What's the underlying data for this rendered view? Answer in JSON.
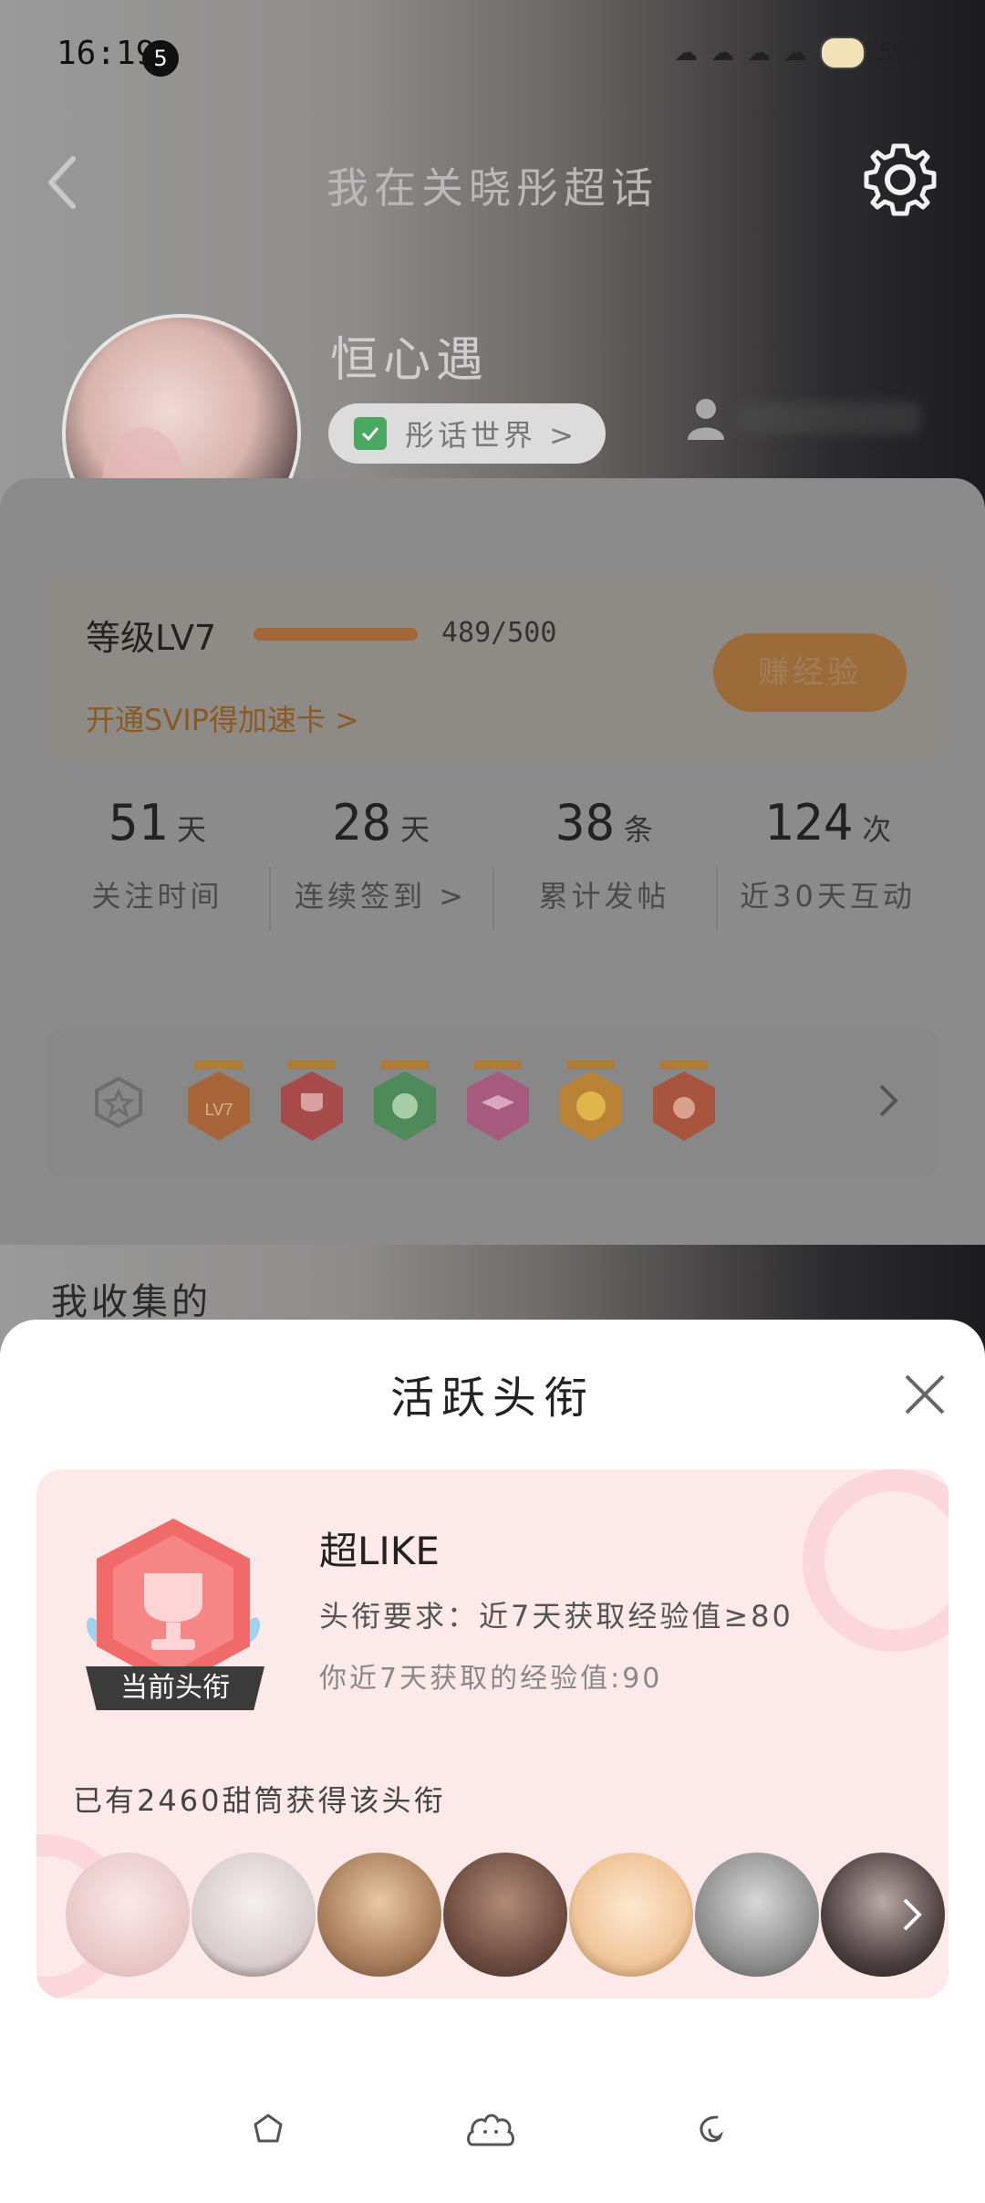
{
  "status_bar": {
    "time": "16:19",
    "notification_count": "5",
    "battery": "59%"
  },
  "nav": {
    "title": "我在关晓彤超话"
  },
  "profile": {
    "username": "恒心遇",
    "world_chip": "彤话世界 >"
  },
  "level": {
    "label": "等级LV7",
    "progress": 0.978,
    "value": "489/500",
    "svip_link": "开通SVIP得加速卡 >",
    "earn_button": "赚经验"
  },
  "stats": [
    {
      "num": "51",
      "unit": "天",
      "label": "关注时间"
    },
    {
      "num": "28",
      "unit": "天",
      "label": "连续签到 >"
    },
    {
      "num": "38",
      "unit": "条",
      "label": "累计发帖"
    },
    {
      "num": "124",
      "unit": "次",
      "label": "近30天互动"
    }
  ],
  "badges": {
    "items": [
      "LV7",
      "trophy",
      "hand",
      "graduation-cap",
      "laugh",
      "rock-hand"
    ],
    "colors": [
      "#e0813f",
      "#e05a5a",
      "#4fb36b",
      "#d9629a",
      "#f0a23a",
      "#e0604d"
    ]
  },
  "collect": {
    "title": "我收集的"
  },
  "sheet": {
    "title": "活跃头衔",
    "badge_name": "超LIKE",
    "current_tag": "当前头衔",
    "requirement": "头衔要求：近7天获取经验值≥80",
    "my_exp": "你近7天获取的经验值:90",
    "holders": "已有2460甜筒获得该头衔",
    "avatar_colors": [
      "#f2d6d6",
      "#e8e2e2",
      "#b98e6a",
      "#6b4a3f",
      "#f4d8b5",
      "#b8b7b7",
      "#3d3535"
    ]
  }
}
